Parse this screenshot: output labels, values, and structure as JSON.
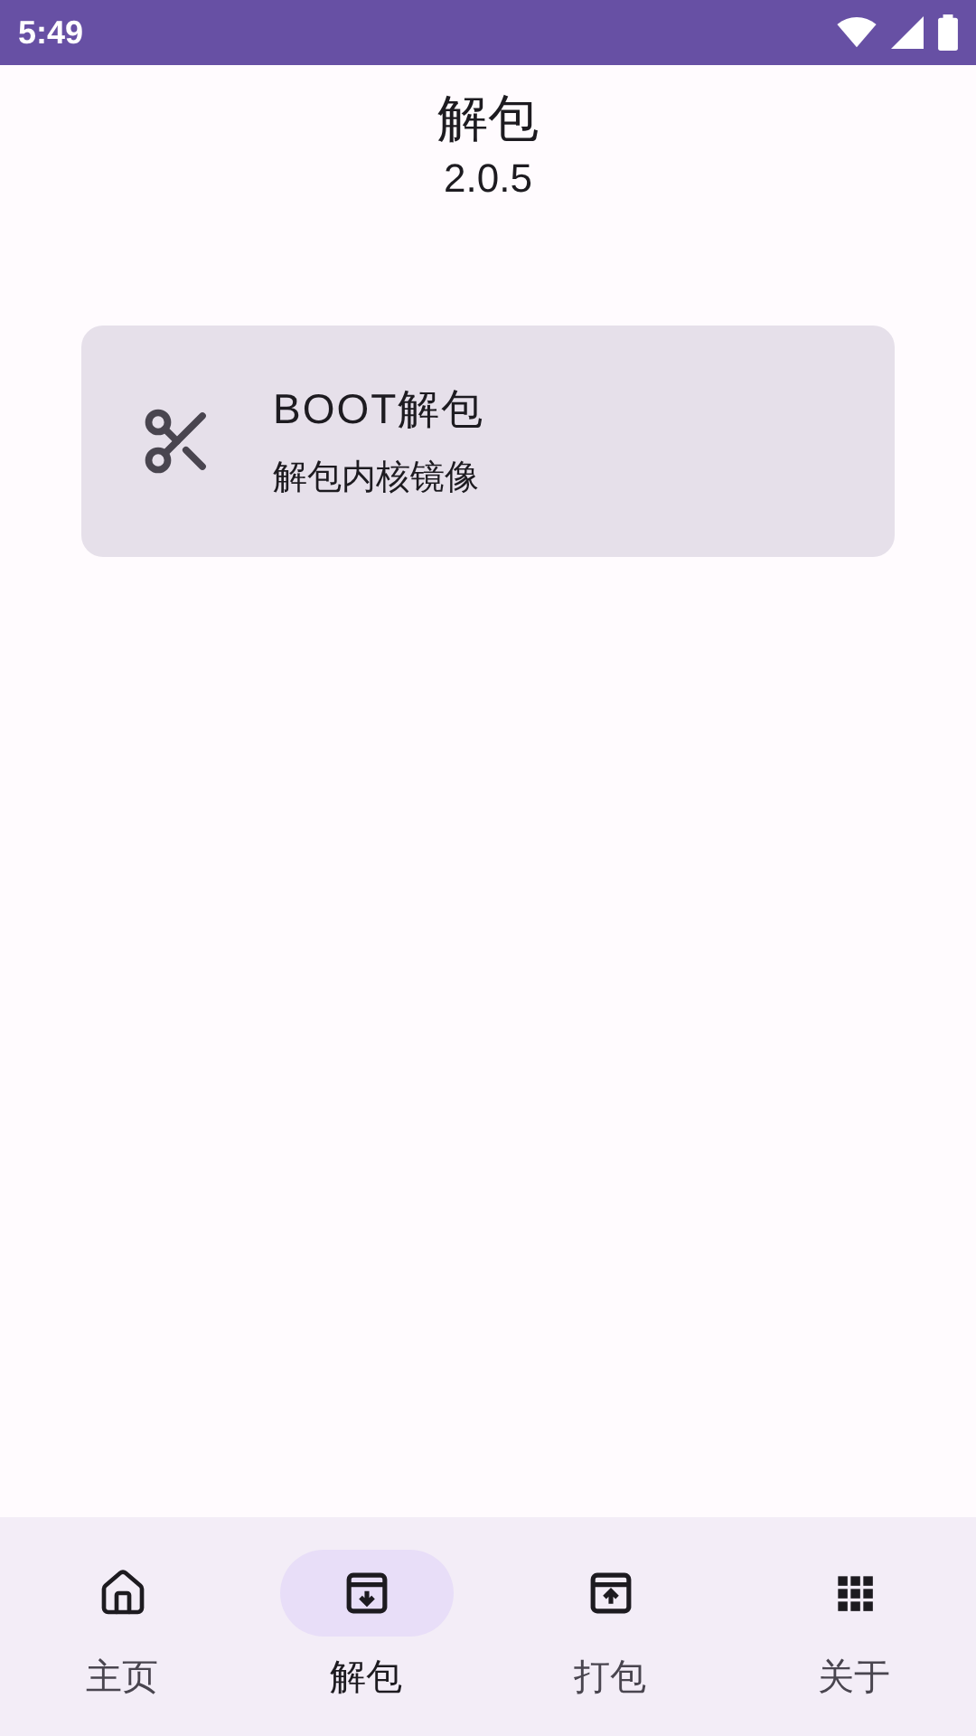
{
  "status_bar": {
    "time": "5:49"
  },
  "header": {
    "title": "解包",
    "version": "2.0.5"
  },
  "cards": [
    {
      "title": "BOOT解包",
      "subtitle": "解包内核镜像"
    }
  ],
  "nav": [
    {
      "label": "主页",
      "kind": "home",
      "selected": false
    },
    {
      "label": "解包",
      "kind": "unpack",
      "selected": true
    },
    {
      "label": "打包",
      "kind": "pack",
      "selected": false
    },
    {
      "label": "关于",
      "kind": "apps",
      "selected": false
    }
  ]
}
